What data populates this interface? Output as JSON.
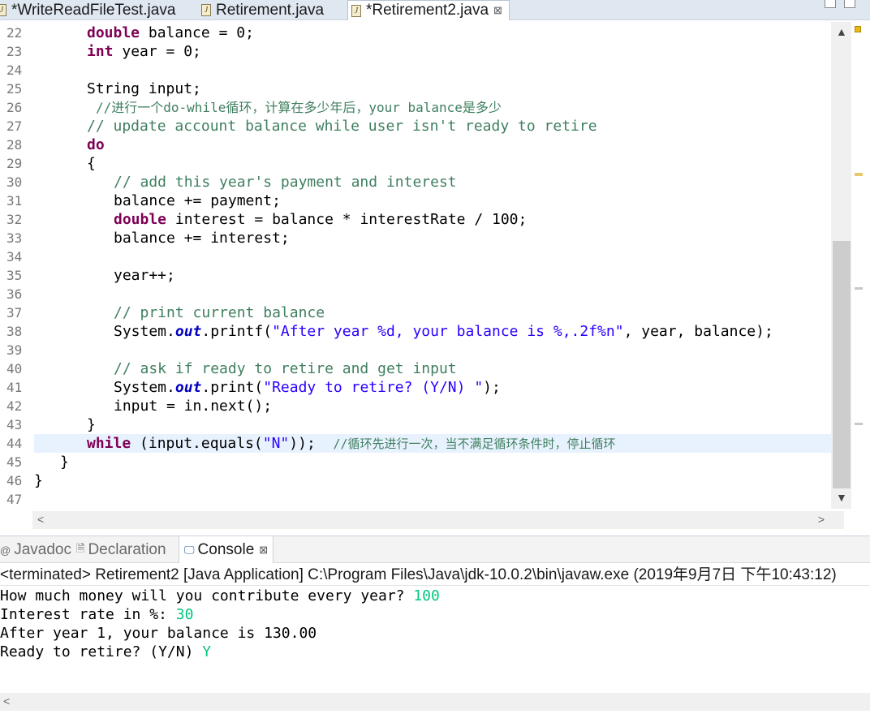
{
  "tabs": [
    {
      "label": "*WriteReadFileTest.java",
      "active": false
    },
    {
      "label": "Retirement.java",
      "active": false
    },
    {
      "label": "*Retirement2.java",
      "active": true
    }
  ],
  "tab_icon": "J",
  "close_glyph": "⊠",
  "code": {
    "line_numbers": [
      "22",
      "23",
      "24",
      "25",
      "26",
      "27",
      "28",
      "29",
      "30",
      "31",
      "32",
      "33",
      "34",
      "35",
      "36",
      "37",
      "38",
      "39",
      "40",
      "41",
      "42",
      "43",
      "44",
      "45",
      "46",
      "47"
    ],
    "highlight_line": "44",
    "lines": {
      "l22": {
        "kw": "double",
        "rest": " balance = 0;"
      },
      "l23": {
        "kw": "int",
        "rest": " year = 0;"
      },
      "l25": {
        "text": "String input;"
      },
      "l26": {
        "comment": "//进行一个do-while循环，计算在多少年后，your balance是多少"
      },
      "l27": {
        "comment": "// update account balance while user isn't ready to retire"
      },
      "l28": {
        "kw": "do"
      },
      "l29": {
        "text": "{"
      },
      "l30": {
        "comment": "// add this year's payment and interest"
      },
      "l31": {
        "text": "balance += payment;"
      },
      "l32": {
        "kw": "double",
        "rest": " interest = balance * interestRate / 100;"
      },
      "l33": {
        "text": "balance += interest;"
      },
      "l35": {
        "text": "year++;"
      },
      "l37": {
        "comment": "// print current balance"
      },
      "l38": {
        "pre": "System.",
        "field": "out",
        "mid": ".printf(",
        "str": "\"After year %d, your balance is %,.2f%n\"",
        "post": ", year, balance);"
      },
      "l40": {
        "comment": "// ask if ready to retire and get input"
      },
      "l41": {
        "pre": "System.",
        "field": "out",
        "mid": ".print(",
        "str": "\"Ready to retire? (Y/N) \"",
        "post": ");"
      },
      "l42": {
        "text": "input = in.next();"
      },
      "l43": {
        "text": "}"
      },
      "l44": {
        "kw": "while",
        "pre": " (input.equals(",
        "str": "\"N\"",
        "post": "));  ",
        "comment": "//循环先进行一次，当不满足循环条件时，停止循环"
      },
      "l45": {
        "text": "}"
      },
      "l46": {
        "text": "}"
      }
    }
  },
  "scroll": {
    "up": "▲",
    "down": "▼",
    "left": "<",
    "right": ">"
  },
  "panel": {
    "tabs": [
      {
        "label": "Javadoc",
        "icon": "@"
      },
      {
        "label": "Declaration",
        "icon": "🗎"
      },
      {
        "label": "Console",
        "icon": "🖵",
        "active": true
      }
    ]
  },
  "console": {
    "terminated": "<terminated> Retirement2 [Java Application] C:\\Program Files\\Java\\jdk-10.0.2\\bin\\javaw.exe (2019年9月7日 下午10:43:12)",
    "lines": [
      {
        "prompt": "How much money will you contribute every year? ",
        "input": "100"
      },
      {
        "prompt": "Interest rate in %: ",
        "input": "30"
      },
      {
        "prompt": "After year 1, your balance is 130.00",
        "input": ""
      },
      {
        "prompt": "Ready to retire? (Y/N) ",
        "input": "Y"
      }
    ]
  },
  "colors": {
    "keyword": "#7f0055",
    "comment": "#3f7f5f",
    "string": "#2a00ff",
    "field": "#0000c0",
    "user_input": "#00c87d",
    "current_line": "#e8f2fe"
  }
}
